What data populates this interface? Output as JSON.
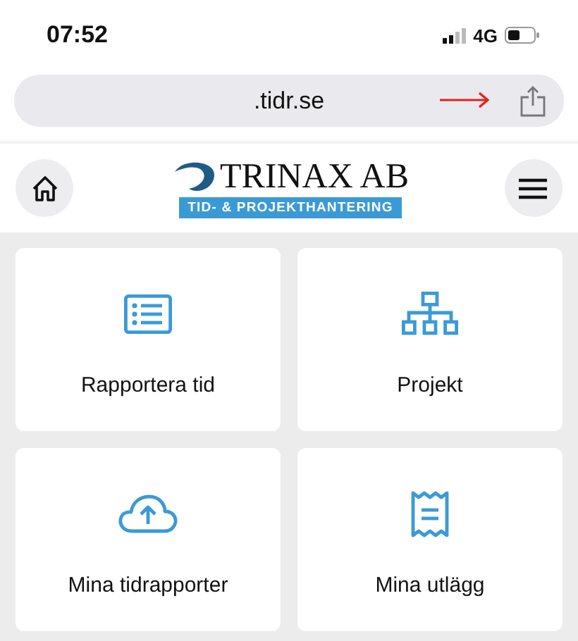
{
  "status_bar": {
    "time": "07:52",
    "network": "4G"
  },
  "address_bar": {
    "url": ".tidr.se"
  },
  "header": {
    "logo_name": "TRINAX AB",
    "logo_tagline": "TID- & PROJEKTHANTERING"
  },
  "tiles": [
    {
      "kind": "list",
      "label": "Rapportera tid"
    },
    {
      "kind": "hierarchy",
      "label": "Projekt"
    },
    {
      "kind": "cloud-upload",
      "label": "Mina tidrapporter"
    },
    {
      "kind": "receipt",
      "label": "Mina utlägg"
    }
  ]
}
